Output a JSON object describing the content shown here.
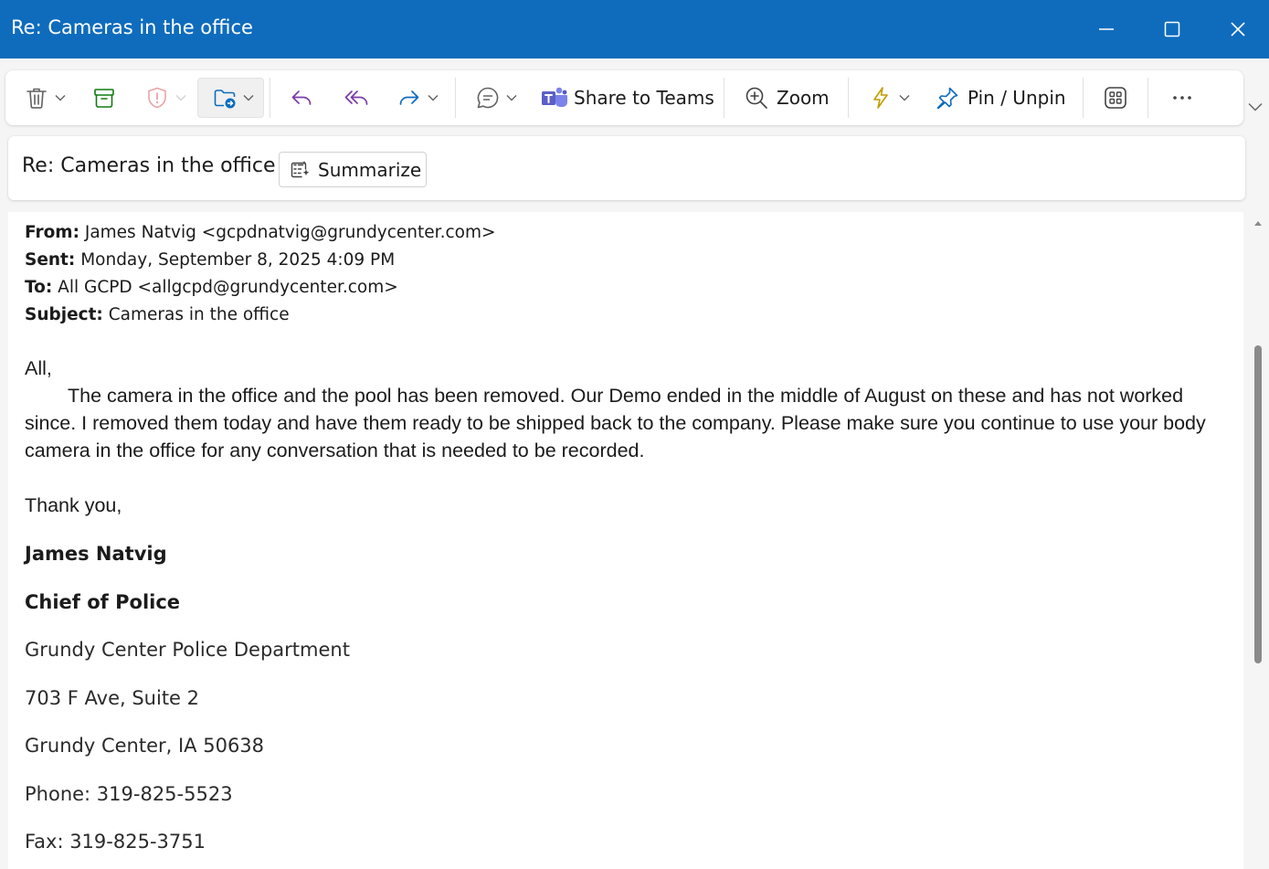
{
  "window": {
    "title": "Re: Cameras in the office"
  },
  "toolbar": {
    "share_to_teams_label": "Share to Teams",
    "zoom_label": "Zoom",
    "pin_label": "Pin / Unpin"
  },
  "subject_bar": {
    "subject": "Re: Cameras in the office",
    "summarize_label": "Summarize"
  },
  "quoted_header": {
    "from_label": "From:",
    "from_value": "James Natvig <gcpdnatvig@grundycenter.com>",
    "sent_label": "Sent:",
    "sent_value": "Monday, September 8, 2025 4:09 PM",
    "to_label": "To:",
    "to_value": "All GCPD <allgcpd@grundycenter.com>",
    "subject_label": "Subject:",
    "subject_value": "Cameras in the office"
  },
  "message": {
    "greeting": "All,",
    "paragraph": "The camera in the office and the pool has been removed.  Our Demo ended in the middle of August on these and has not worked since.  I removed them today and have them ready to be shipped back to the company.  Please make sure you continue to use your body camera in the office for any conversation that is needed to be recorded.",
    "closing": "Thank you,"
  },
  "signature": {
    "name": "James Natvig",
    "title": "Chief of Police",
    "department": "Grundy Center Police Department",
    "address1": "703 F Ave, Suite 2",
    "address2": "Grundy Center, IA 50638",
    "phone": "Phone: 319-825-5523",
    "fax": "Fax: 319-825-3751"
  },
  "colors": {
    "titlebar": "#0f6cbd",
    "reply_purple": "#7b3ba8",
    "forward_blue": "#0f6cbd",
    "archive_green": "#107c10",
    "report_red": "#d13438",
    "quick_steps_gold": "#c19c00",
    "teams_purple": "#5b5fc7"
  },
  "icons": [
    "delete-icon",
    "archive-icon",
    "report-icon",
    "move-icon",
    "reply-icon",
    "reply-all-icon",
    "forward-icon",
    "chat-icon",
    "teams-icon",
    "zoom-icon",
    "quick-steps-icon",
    "pin-icon",
    "apps-icon",
    "more-icon"
  ]
}
